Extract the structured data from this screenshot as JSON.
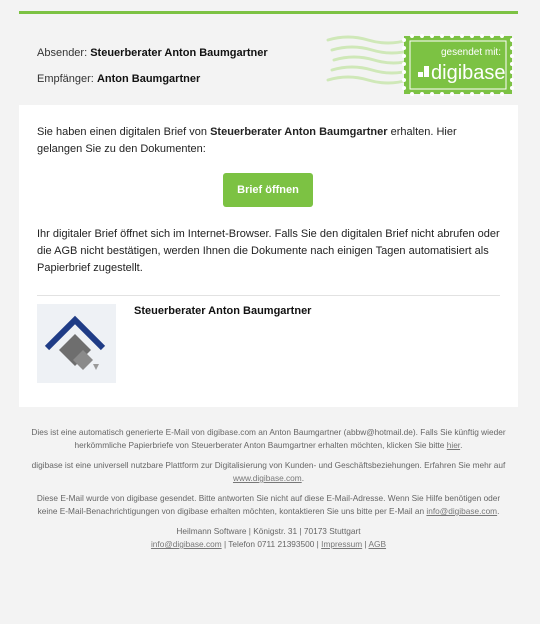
{
  "header": {
    "sender_label": "Absender:",
    "sender_name": "Steuerberater Anton Baumgartner",
    "recipient_label": "Empfänger:",
    "recipient_name": "Anton Baumgartner",
    "stamp_top_text": "gesendet mit:",
    "stamp_brand": "digibase"
  },
  "card": {
    "intro_prefix": "Sie haben einen digitalen Brief von",
    "intro_sender": "Steuerberater Anton Baumgartner",
    "intro_suffix": "erhalten. Hier gelangen Sie zu den Dokumenten:",
    "open_button_label": "Brief öffnen",
    "info_text": "Ihr digitaler Brief öffnet sich im Internet-Browser. Falls Sie den digitalen Brief nicht abrufen oder die AGB nicht bestätigen, werden Ihnen die Dokumente nach einigen Tagen automatisiert als Papierbrief zugestellt.",
    "signature_name": "Steuerberater Anton Baumgartner"
  },
  "footer": {
    "p1_text": "Dies ist eine automatisch generierte E-Mail von digibase.com an Anton Baumgartner (abbw@hotmail.de). Falls Sie künftig wieder herkömmliche Papierbriefe von Steuerberater Anton Baumgartner erhalten möchten, klicken Sie bitte",
    "p1_link": "hier",
    "p1_end": ".",
    "p2_text": "digibase ist eine universell nutzbare Plattform zur Digitalisierung von Kunden- und Geschäftsbeziehungen. Erfahren Sie mehr auf",
    "p2_link": "www.digibase.com",
    "p2_end": ".",
    "p3_text": "Diese E-Mail wurde von digibase gesendet. Bitte antworten Sie nicht auf diese E-Mail-Adresse. Wenn Sie Hilfe benötigen oder keine E-Mail-Benachrichtigungen von digibase erhalten möchten, kontaktieren Sie uns bitte per E-Mail an",
    "p3_link": "info@digibase.com",
    "p3_end": ".",
    "address": "Heilmann Software | Königstr. 31 | 70173 Stuttgart",
    "contact_email": "info@digibase.com",
    "sep1": " | Telefon 0711 21393500 | ",
    "impressum": "Impressum",
    "sep2": " | ",
    "agb": "AGB"
  },
  "colors": {
    "accent": "#7cc243",
    "background": "#f3f3f3",
    "card": "#ffffff"
  }
}
